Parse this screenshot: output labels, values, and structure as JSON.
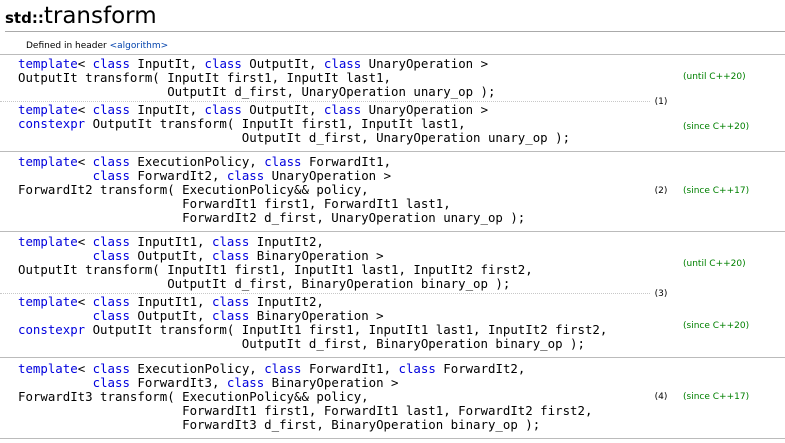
{
  "title": {
    "namespace": "std::",
    "name": "transform"
  },
  "header": {
    "prefix": "Defined in header",
    "link": "<algorithm>"
  },
  "overloads": [
    {
      "code": "template< class InputIt, class OutputIt, class UnaryOperation >\nOutputIt transform( InputIt first1, InputIt last1,\n                    OutputIt d_first, UnaryOperation unary_op );",
      "version": "(until C++20)"
    },
    {
      "code": "template< class InputIt, class OutputIt, class UnaryOperation >\nconstexpr OutputIt transform( InputIt first1, InputIt last1,\n                              OutputIt d_first, UnaryOperation unary_op );",
      "version": "(since C++20)"
    },
    {
      "code": "template< class ExecutionPolicy, class ForwardIt1,\n          class ForwardIt2, class UnaryOperation >\nForwardIt2 transform( ExecutionPolicy&& policy,\n                      ForwardIt1 first1, ForwardIt1 last1,\n                      ForwardIt2 d_first, UnaryOperation unary_op );",
      "version": "(since C++17)"
    },
    {
      "code": "template< class InputIt1, class InputIt2,\n          class OutputIt, class BinaryOperation >\nOutputIt transform( InputIt1 first1, InputIt1 last1, InputIt2 first2,\n                    OutputIt d_first, BinaryOperation binary_op );",
      "version": "(until C++20)"
    },
    {
      "code": "template< class InputIt1, class InputIt2,\n          class OutputIt, class BinaryOperation >\nconstexpr OutputIt transform( InputIt1 first1, InputIt1 last1, InputIt2 first2,\n                              OutputIt d_first, BinaryOperation binary_op );",
      "version": "(since C++20)"
    },
    {
      "code": "template< class ExecutionPolicy, class ForwardIt1, class ForwardIt2,\n          class ForwardIt3, class BinaryOperation >\nForwardIt3 transform( ExecutionPolicy&& policy,\n                      ForwardIt1 first1, ForwardIt1 last1, ForwardIt2 first2,\n                      ForwardIt3 d_first, BinaryOperation binary_op );",
      "version": "(since C++17)"
    }
  ],
  "numbers": [
    "(1)",
    "(2)",
    "(3)",
    "(4)"
  ]
}
